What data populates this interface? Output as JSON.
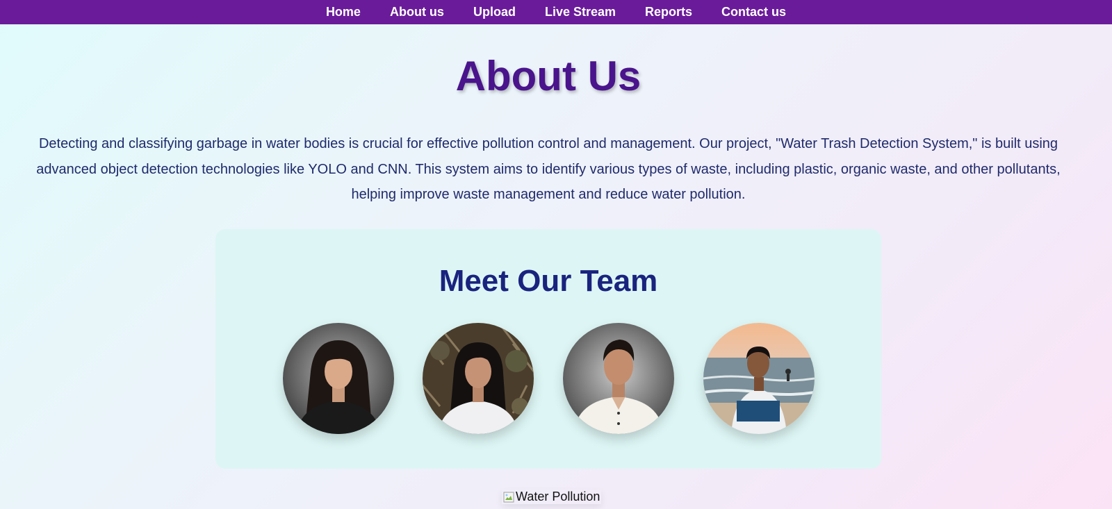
{
  "nav": {
    "items": [
      {
        "label": "Home"
      },
      {
        "label": "About us"
      },
      {
        "label": "Upload"
      },
      {
        "label": "Live Stream"
      },
      {
        "label": "Reports"
      },
      {
        "label": "Contact us"
      }
    ]
  },
  "main": {
    "title": "About Us",
    "intro": "Detecting and classifying garbage in water bodies is crucial for effective pollution control and management. Our project, \"Water Trash Detection System,\" is built using advanced object detection technologies like YOLO and CNN. This system aims to identify various types of waste, including plastic, organic waste, and other pollutants, helping improve waste management and reduce water pollution."
  },
  "team": {
    "heading": "Meet Our Team"
  },
  "image": {
    "alt": "Water Pollution"
  },
  "colors": {
    "nav_bg": "#6a1b9a",
    "title": "#4a148c",
    "text": "#1f2a6b",
    "card_bg": "#ddf6f5"
  }
}
